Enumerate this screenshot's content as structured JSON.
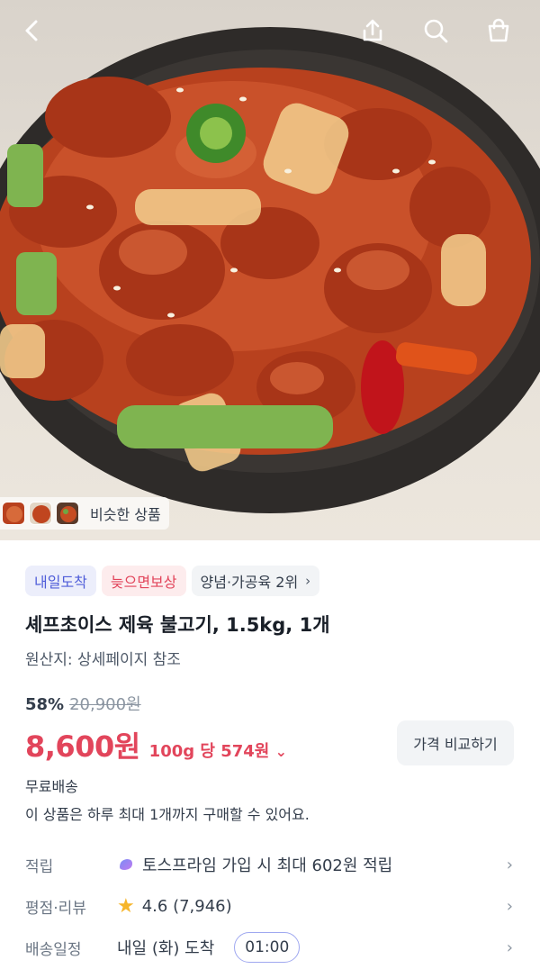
{
  "top_bar": {
    "back_icon": "chevron-left-icon",
    "share_icon": "share-icon",
    "search_icon": "search-icon",
    "cart_icon": "shopping-bag-icon"
  },
  "hero": {
    "similar_label": "비슷한 상품"
  },
  "badges": {
    "tomorrow": "내일도착",
    "late_comp": "늦으면보상",
    "ranking": "양념·가공육 2위",
    "ranking_chevron": "›"
  },
  "product": {
    "title": "셰프초이스 제육 불고기, 1.5kg, 1개",
    "origin": "원산지: 상세페이지 참조",
    "discount": "58%",
    "original_price": "20,900원",
    "price": "8,600원",
    "unit_price": "100g 당 574원",
    "unit_chevron": "⌄",
    "compare_label": "가격 비교하기",
    "shipping": "무료배송",
    "purchase_limit": "이 상품은 하루 최대 1개까지 구매할 수 있어요."
  },
  "rows": {
    "points_label": "적립",
    "points_value": "토스프라임 가입 시 최대 602원 적립",
    "rating_label": "평점·리뷰",
    "rating_value": "4.6 (7,946)",
    "delivery_label": "배송일정",
    "delivery_value": "내일 (화) 도착",
    "delivery_time": "01:00",
    "chevron": "›"
  },
  "colors": {
    "price_red": "#e2455b",
    "badge_blue": "#4f5dd9",
    "star": "#f6b52a"
  }
}
